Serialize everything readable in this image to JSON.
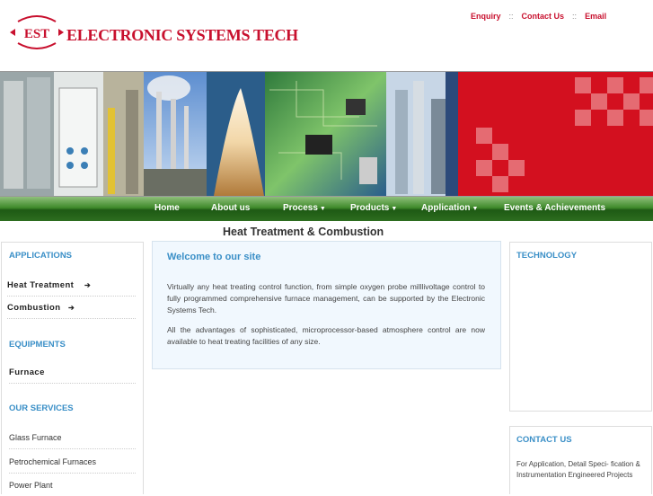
{
  "brand": {
    "mark": "EST",
    "name": "ELECTRONIC SYSTEMS TECH",
    "color": "#c8102e"
  },
  "top_links": [
    "Enquiry",
    "::",
    "Contact Us",
    "::",
    "Email"
  ],
  "nav": {
    "items": [
      {
        "label": "Home",
        "dropdown": false
      },
      {
        "label": "About us",
        "dropdown": false
      },
      {
        "label": "Process",
        "dropdown": true
      },
      {
        "label": "Products",
        "dropdown": true
      },
      {
        "label": "Application",
        "dropdown": true
      },
      {
        "label": "Events & Achievements",
        "dropdown": false
      }
    ],
    "caret": "▼"
  },
  "page_title": "Heat Treatment & Combustion",
  "sidebar": {
    "applications_heading": "APPLICATIONS",
    "applications": [
      {
        "label": "Heat Treatment",
        "arrow": "➔"
      },
      {
        "label": "Combustion",
        "arrow": "➔"
      }
    ],
    "equipments_heading": "EQUIPMENTS",
    "equipments": [
      {
        "label": "Furnace"
      }
    ],
    "services_heading": "OUR SERVICES",
    "services": [
      {
        "label": "Glass Furnace"
      },
      {
        "label": "Petrochemical Furnaces"
      },
      {
        "label": "Power Plant"
      }
    ]
  },
  "main": {
    "heading": "Welcome to our site",
    "paragraphs": [
      "Virtually any heat treating control function, from simple oxygen probe milllivoltage control to fully programmed comprehensive furnace management, can be supported by the Electronic Systems Tech.",
      "All the advantages of sophisticated, microprocessor-based atmosphere control are now available to heat treating facilities of any size."
    ]
  },
  "right": {
    "technology_heading": "TECHNOLOGY",
    "contact_heading": "CONTACT US",
    "contact_text": "For Application, Detail Speci- fication & Instrumentation Engineered Projects"
  },
  "colors": {
    "accent_blue": "#3a8fc7",
    "nav_green": "#2d6d1f",
    "banner_red": "#d3101f"
  }
}
